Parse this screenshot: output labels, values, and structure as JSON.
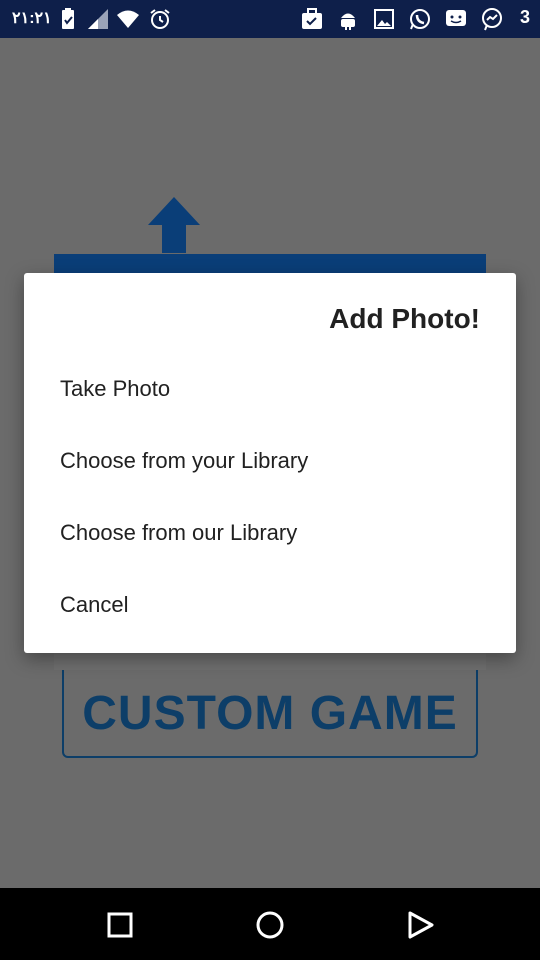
{
  "status_bar": {
    "time": "٢١:٢١",
    "notification_count": "3",
    "icons": [
      "battery-icon",
      "signal-icon",
      "wifi-icon",
      "alarm-icon",
      "briefcase-icon",
      "android-icon",
      "image-icon",
      "whatsapp-icon",
      "chat-icon",
      "messenger-icon"
    ]
  },
  "background": {
    "custom_game_label": "CUSTOM GAME",
    "accent_color": "#0d3e68"
  },
  "dialog": {
    "title": "Add Photo!",
    "options": [
      {
        "label": "Take Photo"
      },
      {
        "label": "Choose from your Library"
      },
      {
        "label": "Choose from our Library"
      },
      {
        "label": "Cancel"
      }
    ]
  },
  "nav_bar": {
    "buttons": [
      "recents-icon",
      "home-icon",
      "back-icon"
    ]
  }
}
